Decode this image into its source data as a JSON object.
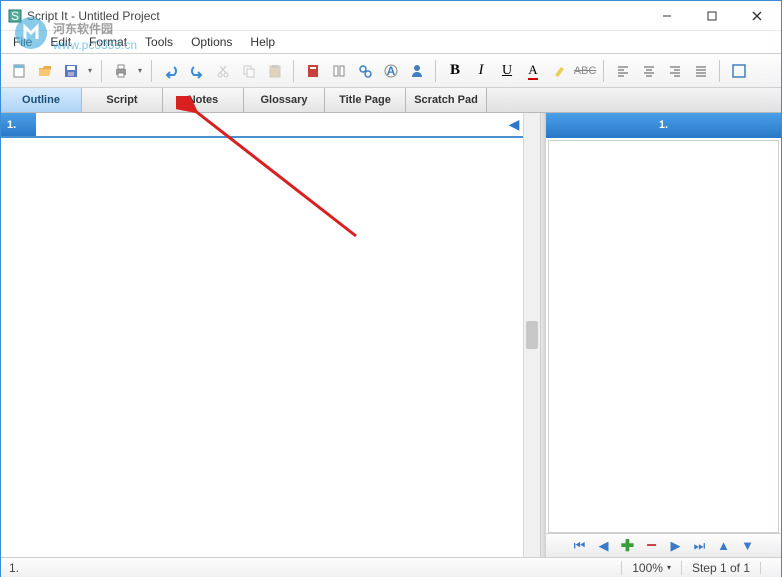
{
  "window": {
    "title": "Script It - Untitled Project"
  },
  "menu": {
    "items": [
      "File",
      "Edit",
      "Format",
      "Tools",
      "Options",
      "Help"
    ]
  },
  "tabs": {
    "items": [
      "Outline",
      "Script",
      "Notes",
      "Glossary",
      "Title Page",
      "Scratch Pad"
    ],
    "active": 0
  },
  "row": {
    "num": "1."
  },
  "rightPanel": {
    "head": "1."
  },
  "status": {
    "left": "1.",
    "zoom": "100%",
    "step": "Step 1 of 1"
  },
  "watermark": {
    "line1": "河东软件园",
    "line2": "www.pc0359.cn"
  }
}
